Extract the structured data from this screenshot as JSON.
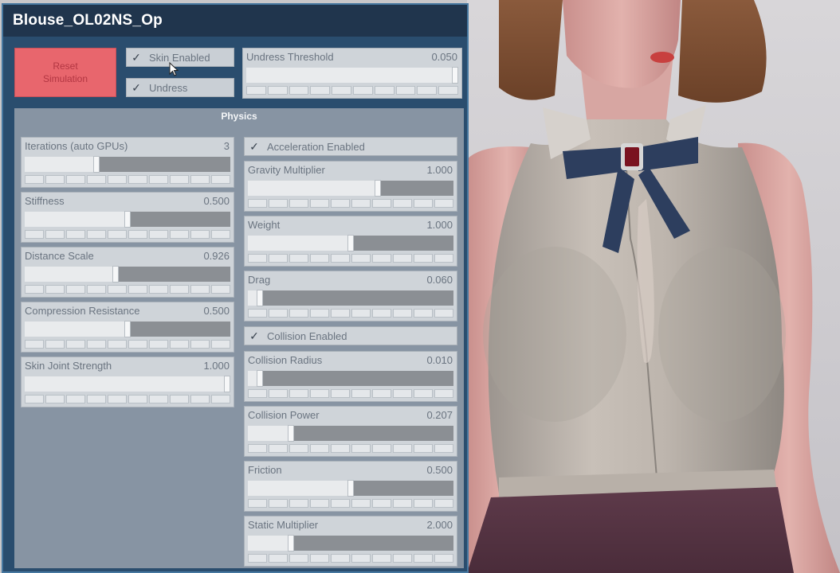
{
  "panel": {
    "title": "Blouse_OL02NS_Op",
    "reset_button": "Reset\nSimulation",
    "skin_enabled": {
      "label": "Skin Enabled",
      "checked": true
    },
    "undress": {
      "label": "Undress",
      "checked": true
    },
    "undress_threshold": {
      "label": "Undress Threshold",
      "value": "0.050",
      "fraction": 1.0
    }
  },
  "physics": {
    "header": "Physics",
    "left_sliders": [
      {
        "label": "Iterations (auto GPUs)",
        "value": "3",
        "fraction": 0.35
      },
      {
        "label": "Stiffness",
        "value": "0.500",
        "fraction": 0.5
      },
      {
        "label": "Distance Scale",
        "value": "0.926",
        "fraction": 0.44
      },
      {
        "label": "Compression Resistance",
        "value": "0.500",
        "fraction": 0.5
      },
      {
        "label": "Skin Joint Strength",
        "value": "1.000",
        "fraction": 1.0
      }
    ],
    "acceleration_enabled": {
      "label": "Acceleration Enabled",
      "checked": true
    },
    "collision_enabled": {
      "label": "Collision Enabled",
      "checked": true
    },
    "right_sliders_a": [
      {
        "label": "Gravity Multiplier",
        "value": "1.000",
        "fraction": 0.63
      },
      {
        "label": "Weight",
        "value": "1.000",
        "fraction": 0.5
      },
      {
        "label": "Drag",
        "value": "0.060",
        "fraction": 0.06
      }
    ],
    "right_sliders_b": [
      {
        "label": "Collision Radius",
        "value": "0.010",
        "fraction": 0.06
      },
      {
        "label": "Collision Power",
        "value": "0.207",
        "fraction": 0.21
      },
      {
        "label": "Friction",
        "value": "0.500",
        "fraction": 0.5
      },
      {
        "label": "Static Multiplier",
        "value": "2.000",
        "fraction": 0.21
      }
    ]
  },
  "colors": {
    "panel_bg": "#2a4d6e",
    "title_bg": "#20354d",
    "reset_bg": "#e8666d",
    "physics_bg": "#8794a3"
  }
}
